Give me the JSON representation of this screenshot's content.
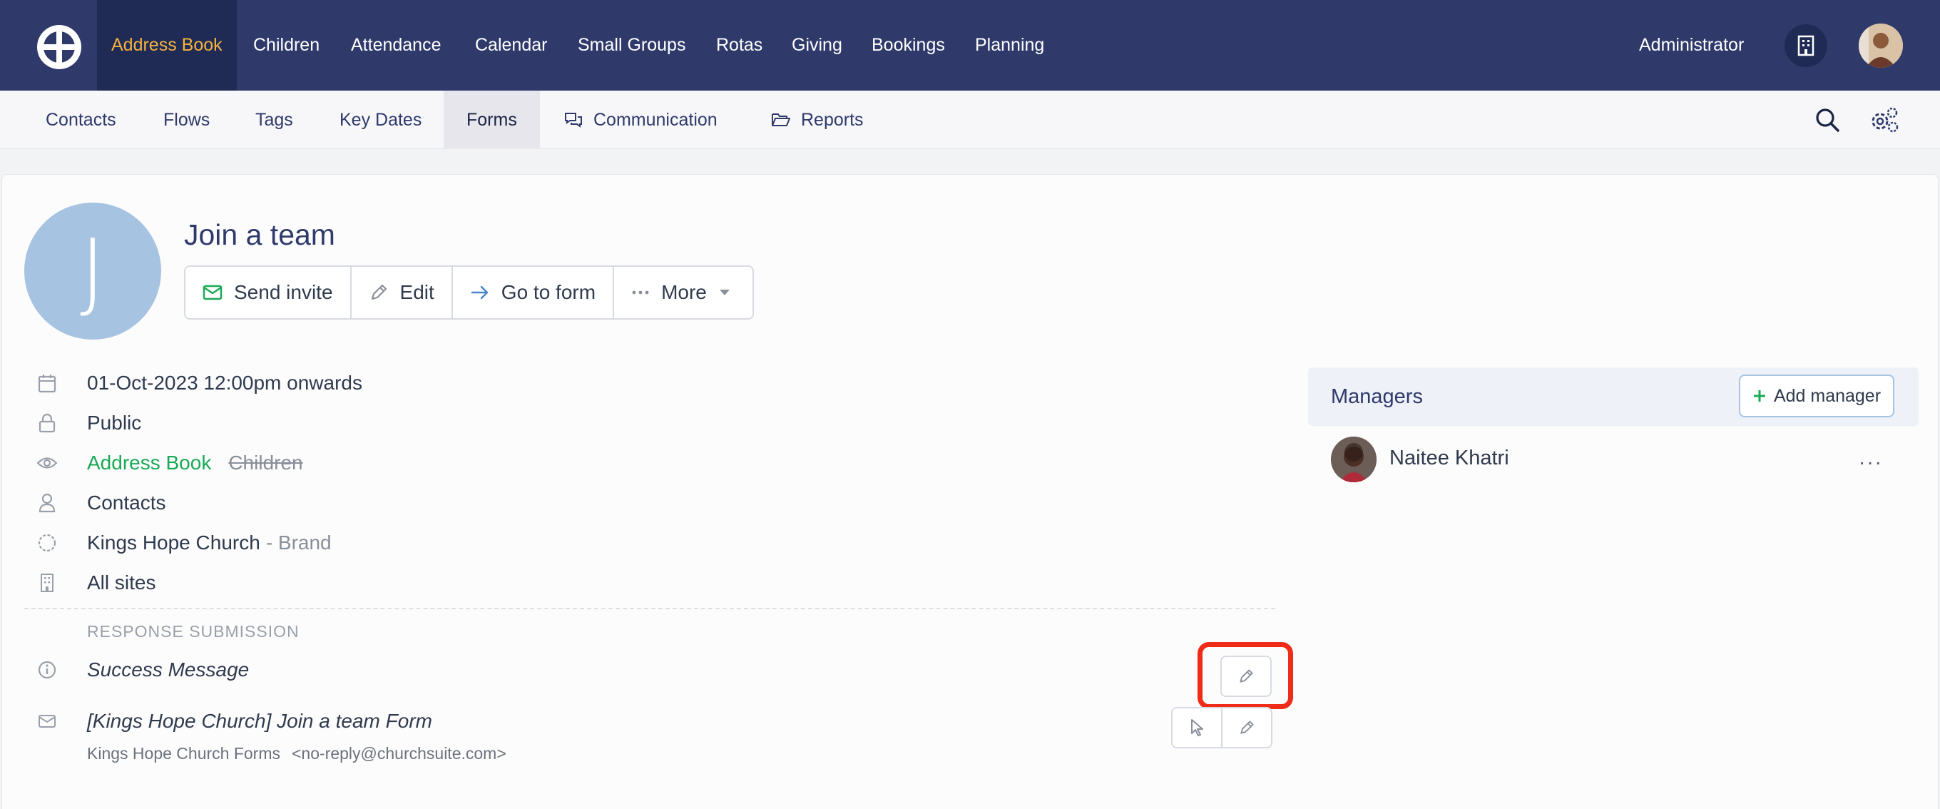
{
  "topnav": {
    "items": [
      "Address Book",
      "Children",
      "Attendance",
      "Calendar",
      "Small Groups",
      "Rotas",
      "Giving",
      "Bookings",
      "Planning"
    ],
    "active": "Address Book",
    "user_role": "Administrator"
  },
  "subnav": {
    "items": [
      "Contacts",
      "Flows",
      "Tags",
      "Key Dates",
      "Forms",
      "Communication",
      "Reports"
    ],
    "active": "Forms"
  },
  "form": {
    "avatar_letter": "J",
    "title": "Join a team",
    "actions": {
      "send_invite": "Send invite",
      "edit": "Edit",
      "go_to_form": "Go to form",
      "more": "More"
    },
    "details": {
      "date": "01-Oct-2023 12:00pm onwards",
      "visibility": "Public",
      "module_enabled": "Address Book",
      "module_disabled": "Children",
      "type": "Contacts",
      "brand_name": "Kings Hope Church",
      "brand_suffix": "- Brand",
      "sites": "All sites"
    },
    "response_section": {
      "label": "RESPONSE SUBMISSION",
      "success_message": "Success Message",
      "email_subject": "[Kings Hope Church] Join a team Form",
      "email_from_name": "Kings Hope Church Forms",
      "email_from_address": "<no-reply@churchsuite.com>"
    }
  },
  "managers": {
    "title": "Managers",
    "add_label": "Add manager",
    "list": [
      {
        "name": "Naitee Khatri"
      }
    ],
    "more_label": "···"
  },
  "colors": {
    "topbar": "#2f3a6b",
    "active_nav_text": "#f4b23e",
    "accent_green": "#1aaa55",
    "highlight": "#ee2c17",
    "avatar_bg": "#a7c3e2"
  }
}
